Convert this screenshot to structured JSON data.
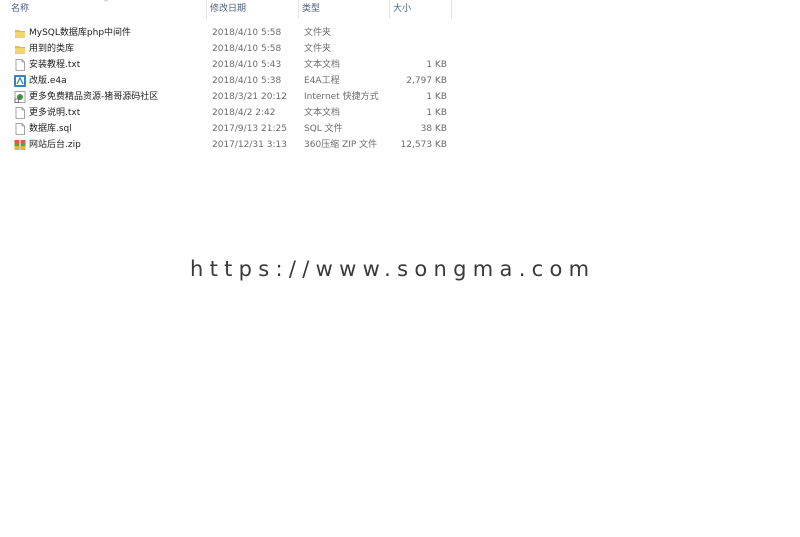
{
  "header": {
    "name": "名称",
    "date": "修改日期",
    "type": "类型",
    "size": "大小"
  },
  "files": [
    {
      "name": "MySQL数据库php中间件",
      "date": "2018/4/10 5:58",
      "type": "文件夹",
      "size": "",
      "icon": "folder-icon"
    },
    {
      "name": "用到的类库",
      "date": "2018/4/10 5:58",
      "type": "文件夹",
      "size": "",
      "icon": "folder-icon"
    },
    {
      "name": "安装教程.txt",
      "date": "2018/4/10 5:43",
      "type": "文本文档",
      "size": "1 KB",
      "icon": "text-file-icon"
    },
    {
      "name": "改版.e4a",
      "date": "2018/4/10 5:38",
      "type": "E4A工程",
      "size": "2,797 KB",
      "icon": "e4a-project-icon"
    },
    {
      "name": "更多免费精品资源-猪哥源码社区",
      "date": "2018/3/21 20:12",
      "type": "Internet 快捷方式",
      "size": "1 KB",
      "icon": "internet-shortcut-icon"
    },
    {
      "name": "更多说明.txt",
      "date": "2018/4/2 2:42",
      "type": "文本文档",
      "size": "1 KB",
      "icon": "text-file-icon"
    },
    {
      "name": "数据库.sql",
      "date": "2017/9/13 21:25",
      "type": "SQL 文件",
      "size": "38 KB",
      "icon": "sql-file-icon"
    },
    {
      "name": "网站后台.zip",
      "date": "2017/12/31 3:13",
      "type": "360压缩 ZIP 文件",
      "size": "12,573 KB",
      "icon": "zip-archive-icon"
    }
  ],
  "watermark": "https://www.songma.com"
}
